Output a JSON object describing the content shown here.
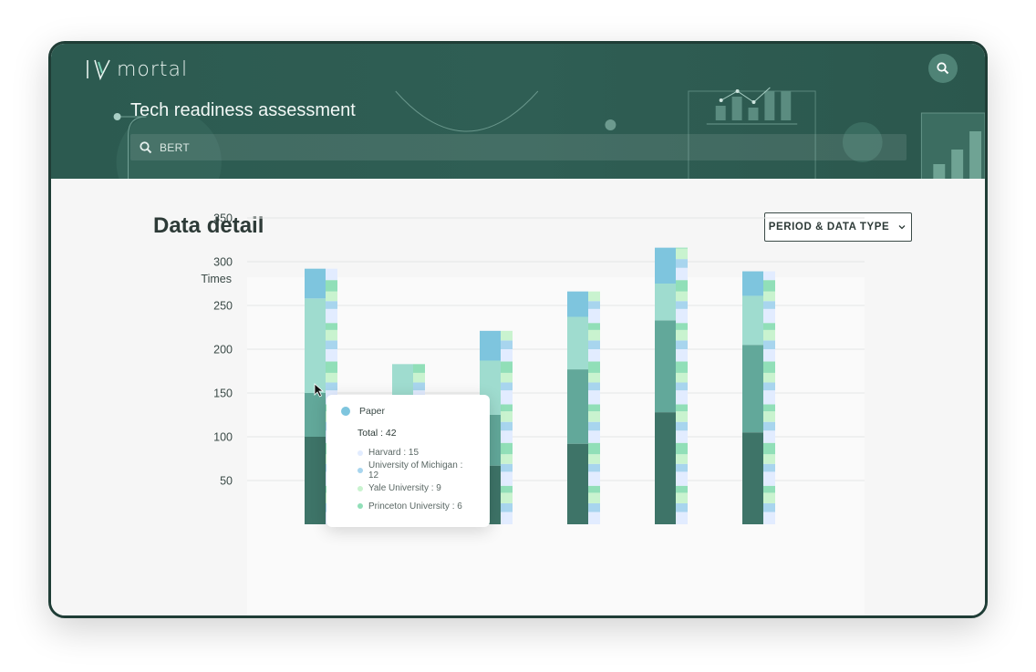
{
  "app": {
    "logo_text": "mortal",
    "logo_mark": "IV-mark"
  },
  "header": {
    "title": "Tech readiness assessment",
    "search_icon": "search-icon"
  },
  "search": {
    "value": "BERT"
  },
  "section": {
    "title": "Data detail",
    "filter_label": "PERIOD & DATA TYPE",
    "filter_icon": "chevron-down-icon"
  },
  "colors": {
    "header_bg": "#2e5c52",
    "paper": "#7ec5de",
    "teal_light": "#9fdccf",
    "teal_mid": "#62a89a",
    "teal_dark": "#3e7468",
    "harvard": "#e2ecff",
    "michigan": "#a8d5ee",
    "yale": "#c9f3cf",
    "princeton": "#91dfb8"
  },
  "chart_data": {
    "type": "bar",
    "ylabel": "Times",
    "yticks": [
      50,
      100,
      150,
      200,
      250,
      300,
      350
    ],
    "ylim": [
      0,
      375
    ],
    "groups": 6,
    "stacks": [
      {
        "dark": 100,
        "mid": 50,
        "light": 108,
        "paper": 34
      },
      {
        "dark": 87,
        "mid": 30,
        "light": 66,
        "paper": 0
      },
      {
        "dark": 67,
        "mid": 58,
        "light": 62,
        "paper": 34
      },
      {
        "dark": 92,
        "mid": 85,
        "light": 60,
        "paper": 29
      },
      {
        "dark": 128,
        "mid": 105,
        "light": 42,
        "paper": 41
      },
      {
        "dark": 105,
        "mid": 100,
        "light": 56,
        "paper": 28
      }
    ],
    "detail_series": [
      "Harvard",
      "University of Michigan",
      "Yale University",
      "Princeton University"
    ]
  },
  "tooltip": {
    "series": "Paper",
    "total": "Total : 42",
    "items": [
      {
        "label": "Harvard : 15",
        "color": "#e2ecff"
      },
      {
        "label": "University of Michigan : 12",
        "color": "#a8d5ee"
      },
      {
        "label": "Yale University : 9",
        "color": "#c9f3cf"
      },
      {
        "label": "Princeton University : 6",
        "color": "#91dfb8"
      }
    ]
  }
}
